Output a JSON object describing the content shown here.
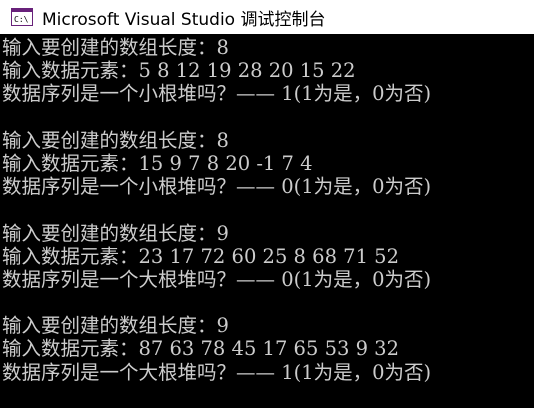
{
  "window": {
    "title": "Microsoft Visual Studio 调试控制台",
    "icon": "console-app-icon"
  },
  "console": {
    "lines": [
      "输入要创建的数组长度：8",
      "输入数据元素：5 8 12 19 28 20 15 22",
      "数据序列是一个小根堆吗？—— 1(1为是，0为否)",
      "",
      "输入要创建的数组长度：8",
      "输入数据元素：15 9 7 8 20 -1 7 4",
      "数据序列是一个小根堆吗？—— 0(1为是，0为否)",
      "",
      "输入要创建的数组长度：9",
      "输入数据元素：23 17 72 60 25 8 68 71 52",
      "数据序列是一个大根堆吗？—— 0(1为是，0为否)",
      "",
      "输入要创建的数组长度：9",
      "输入数据元素：87 63 78 45 17 65 53 9 32",
      "数据序列是一个大根堆吗？—— 1(1为是，0为否)"
    ]
  }
}
